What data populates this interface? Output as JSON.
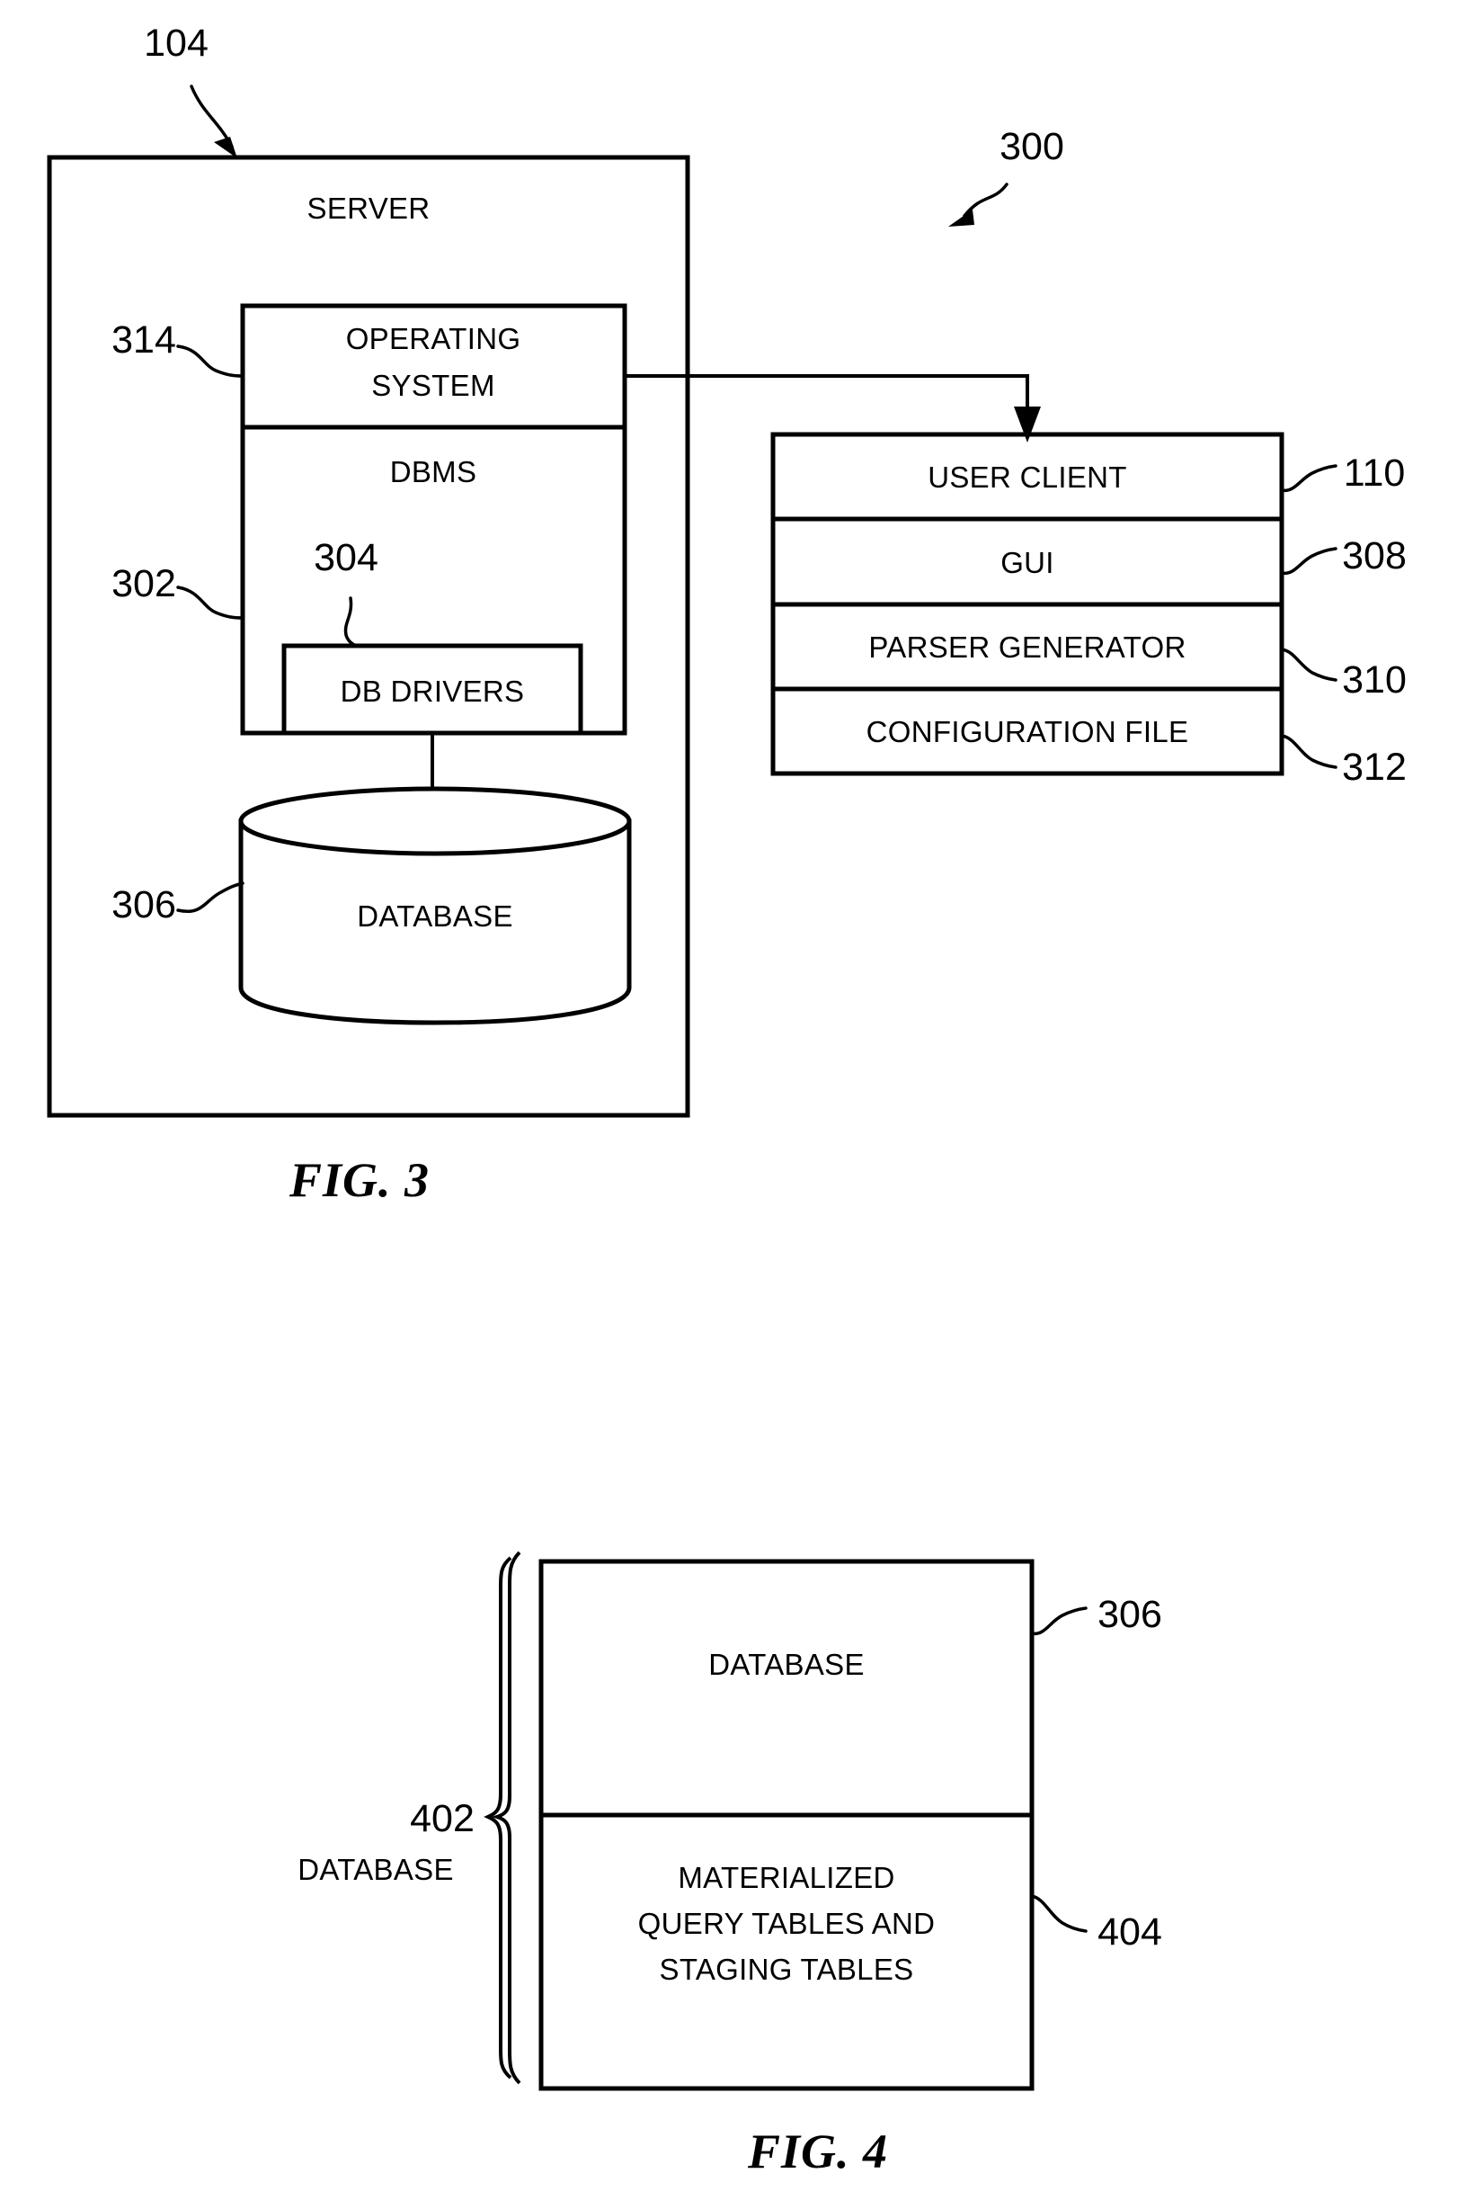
{
  "document": {
    "type": "patent-drawing-sheet",
    "figures": [
      "FIG. 3",
      "FIG. 4"
    ]
  },
  "fig3": {
    "caption": "FIG. 3",
    "system_ref": "300",
    "server": {
      "label": "SERVER",
      "ref": "104"
    },
    "operating_system": {
      "label_line1": "OPERATING",
      "label_line2": "SYSTEM",
      "ref": "314"
    },
    "dbms": {
      "label": "DBMS",
      "ref": "302"
    },
    "db_drivers": {
      "label": "DB DRIVERS",
      "ref": "304"
    },
    "database": {
      "label": "DATABASE",
      "ref": "306"
    },
    "client_stack": [
      {
        "label": "USER CLIENT",
        "ref": "110"
      },
      {
        "label": "GUI",
        "ref": "308"
      },
      {
        "label": "PARSER GENERATOR",
        "ref": "310"
      },
      {
        "label": "CONFIGURATION FILE",
        "ref": "312"
      }
    ]
  },
  "fig4": {
    "caption": "FIG. 4",
    "brace_ref": "402",
    "brace_label": "DATABASE",
    "rows": [
      {
        "label_lines": [
          "DATABASE"
        ],
        "ref": "306"
      },
      {
        "label_lines": [
          "MATERIALIZED",
          "QUERY TABLES AND",
          "STAGING TABLES"
        ],
        "ref": "404"
      }
    ]
  },
  "colors": {
    "ink": "#000000",
    "paper": "#ffffff"
  }
}
